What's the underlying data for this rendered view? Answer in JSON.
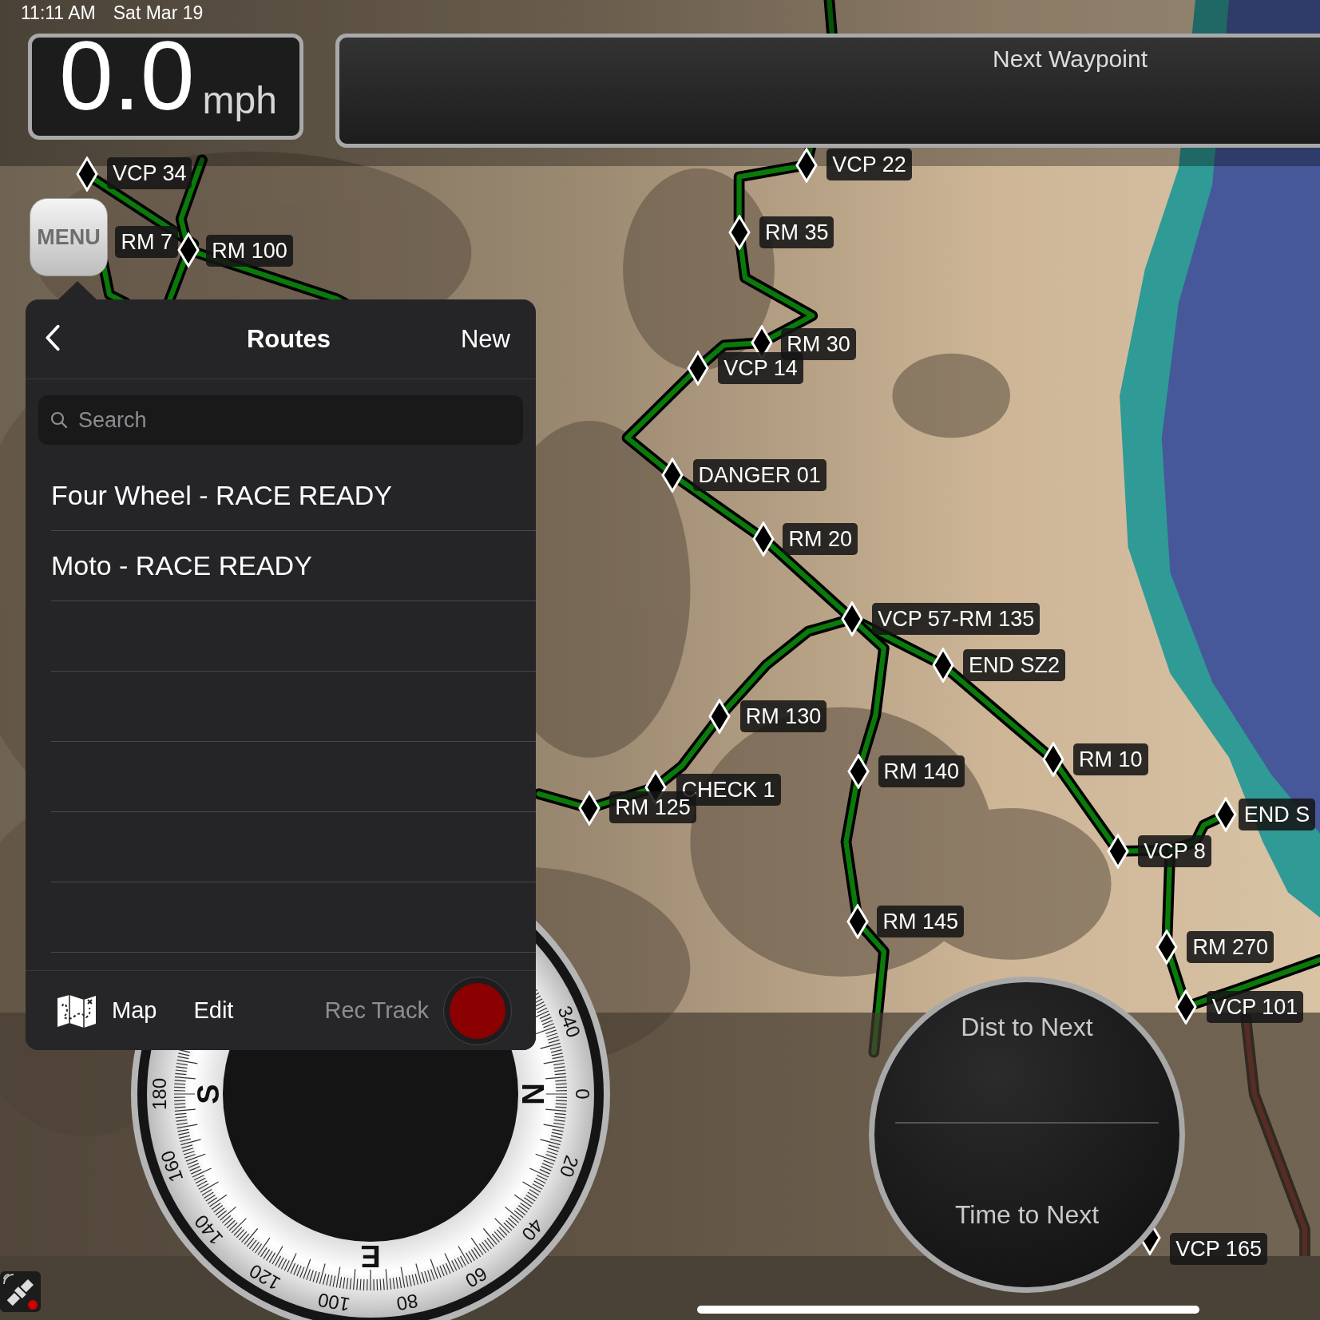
{
  "status_bar": {
    "time": "11:11 AM",
    "date": "Sat Mar 19"
  },
  "speed": {
    "value": "0.0",
    "unit": "mph"
  },
  "next_waypoint": {
    "title": "Next Waypoint"
  },
  "menu_button": {
    "label": "MENU"
  },
  "waypoints": [
    {
      "label": "VCP 34"
    },
    {
      "label": "RM 7"
    },
    {
      "label": "RM 100"
    },
    {
      "label": "VCP 22"
    },
    {
      "label": "RM 35"
    },
    {
      "label": "RM 30"
    },
    {
      "label": "VCP 14"
    },
    {
      "label": "DANGER 01"
    },
    {
      "label": "RM 20"
    },
    {
      "label": "VCP 57-RM 135"
    },
    {
      "label": "END SZ2"
    },
    {
      "label": "RM 130"
    },
    {
      "label": "RM 140"
    },
    {
      "label": "RM 10"
    },
    {
      "label": "CHECK 1"
    },
    {
      "label": "RM 125"
    },
    {
      "label": "VCP 8"
    },
    {
      "label": "END S"
    },
    {
      "label": "RM 270"
    },
    {
      "label": "RM 145"
    },
    {
      "label": "VCP 101"
    },
    {
      "label": "VCP 165"
    }
  ],
  "routes_popover": {
    "title": "Routes",
    "new_button": "New",
    "search": {
      "placeholder": "Search"
    },
    "routes": [
      {
        "name": "Four Wheel - RACE READY"
      },
      {
        "name": "Moto - RACE READY"
      }
    ],
    "toolbar": {
      "map": "Map",
      "edit": "Edit",
      "rec_track": "Rec Track"
    }
  },
  "compass": {
    "cardinals": [
      "N",
      "E",
      "S"
    ],
    "degrees": [
      "0",
      "20",
      "40",
      "60",
      "80",
      "100",
      "120",
      "140",
      "160",
      "180",
      "340"
    ]
  },
  "next_info": {
    "dist_label": "Dist to Next",
    "time_label": "Time to Next"
  }
}
